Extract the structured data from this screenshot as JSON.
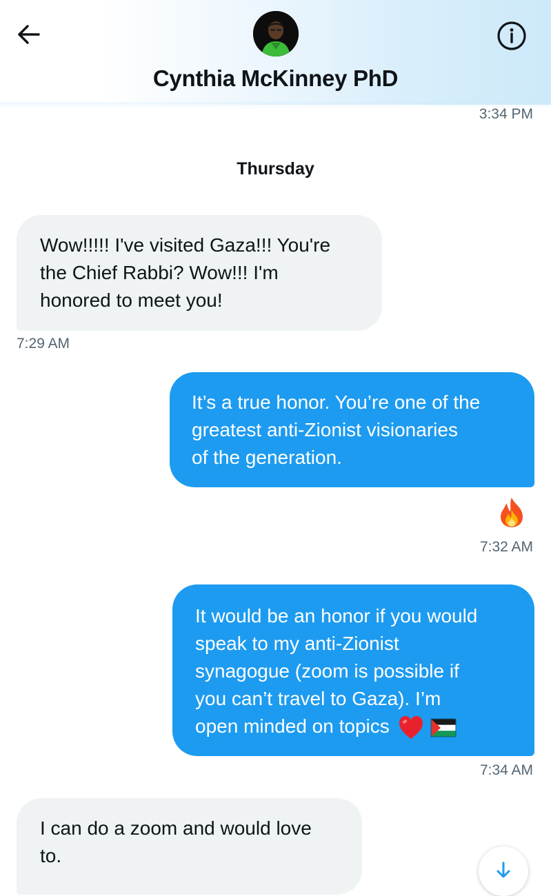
{
  "header": {
    "contact_name": "Cynthia McKinney PhD",
    "back_icon": "arrow-left-icon",
    "info_icon": "info-circle-icon"
  },
  "timestamps": {
    "top": "3:34 PM"
  },
  "day_separator": "Thursday",
  "messages": [
    {
      "direction": "incoming",
      "lines": [
        "Wow!!!!! I've visited Gaza!!!  You're",
        "the Chief Rabbi?  Wow!!!  I'm",
        "honored to meet you!"
      ],
      "time": "7:29 AM"
    },
    {
      "direction": "outgoing",
      "lines": [
        "It’s a true honor. You’re one of the",
        "greatest anti-Zionist visionaries",
        "of the generation."
      ],
      "reaction": "fire-emoji",
      "time": "7:32 AM"
    },
    {
      "direction": "outgoing",
      "lines": [
        "It would be an honor if you would",
        "speak to my anti-Zionist",
        "synagogue (zoom is possible if",
        "you can’t travel to Gaza). I’m",
        "open minded on topics"
      ],
      "emojis": [
        "red-heart-emoji",
        "palestine-flag-emoji"
      ],
      "time": "7:34 AM"
    },
    {
      "direction": "incoming",
      "lines": [
        "I can do a zoom and would love",
        "to."
      ]
    }
  ],
  "scroll_button_icon": "arrow-down-icon",
  "colors": {
    "outgoing_bubble": "#1d9bf0",
    "incoming_bubble": "#eff3f4",
    "timestamp": "#536471",
    "text": "#0f1419"
  }
}
